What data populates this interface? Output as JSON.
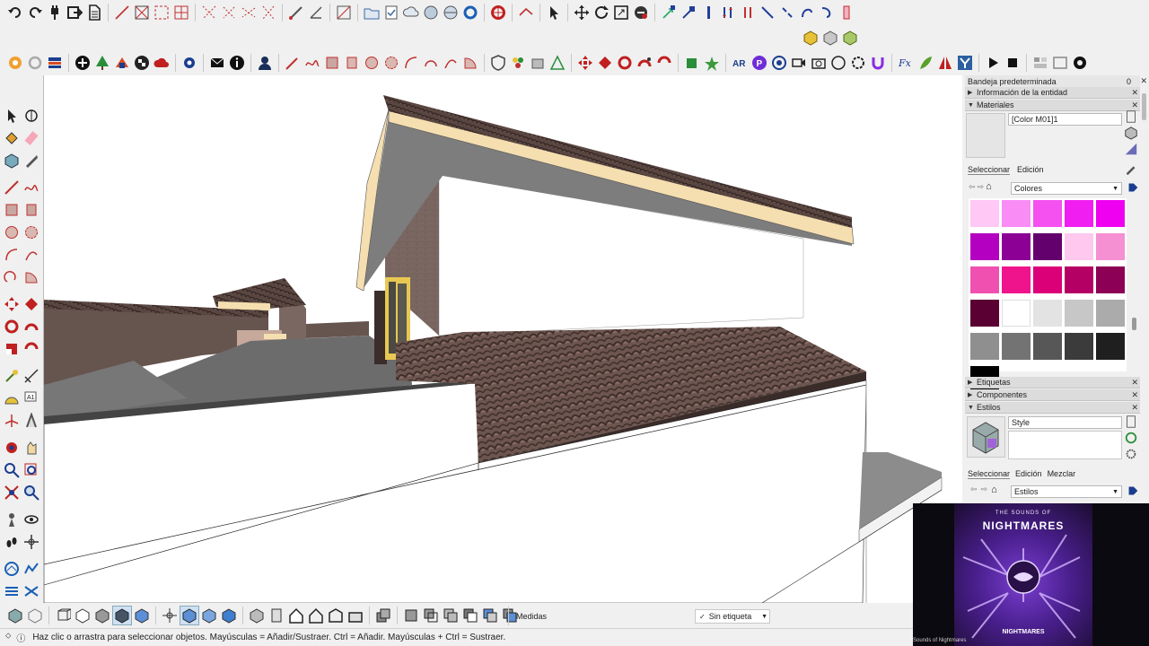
{
  "right_panel": {
    "tray_title": "Bandeja predeterminada",
    "tray_count": "0",
    "entity_info_label": "Información de la entidad",
    "materials_label": "Materiales",
    "material_name": "[Color M01]1",
    "materials_tabs": [
      "Seleccionar",
      "Edición"
    ],
    "materials_library": "Colores",
    "swatches": [
      "#ffc8f5",
      "#f98cf5",
      "#f550f0",
      "#f01ef0",
      "#f000f0",
      "#b400c0",
      "#8c0095",
      "#64006e",
      "#ffc8ee",
      "#f590d2",
      "#f050b0",
      "#f0148c",
      "#dc0078",
      "#b40064",
      "#8c0055",
      "#5a0032",
      "#ffffff",
      "#e3e3e3",
      "#c7c7c7",
      "#ababab",
      "#8f8f8f",
      "#737373",
      "#575757",
      "#3b3b3b",
      "#1f1f1f",
      "#000000"
    ],
    "tags_label": "Etiquetas",
    "components_label": "Componentes",
    "styles_label": "Estilos",
    "style_name": "Style",
    "styles_tabs": [
      "Seleccionar",
      "Edición",
      "Mezclar"
    ],
    "styles_library": "Estilos"
  },
  "bottom": {
    "measurements_label": "Medidas",
    "tag_value": "Sin etiqueta"
  },
  "status": {
    "hint": "Haz clic o arrastra para seleccionar objetos. Mayúsculas = Añadir/Sustraer. Ctrl = Añadir. Mayúsculas + Ctrl = Sustraer."
  },
  "album": {
    "line1": "THE SOUNDS OF",
    "line2": "NIGHTMARES",
    "brand": "NIGHTMARES",
    "caption": "Sounds of Nightmares"
  },
  "colors": {
    "roof_tile": "#6e5650",
    "wall_brick": "#7b6762",
    "fascia": "#f5deb0",
    "accent": "#a064d8"
  }
}
